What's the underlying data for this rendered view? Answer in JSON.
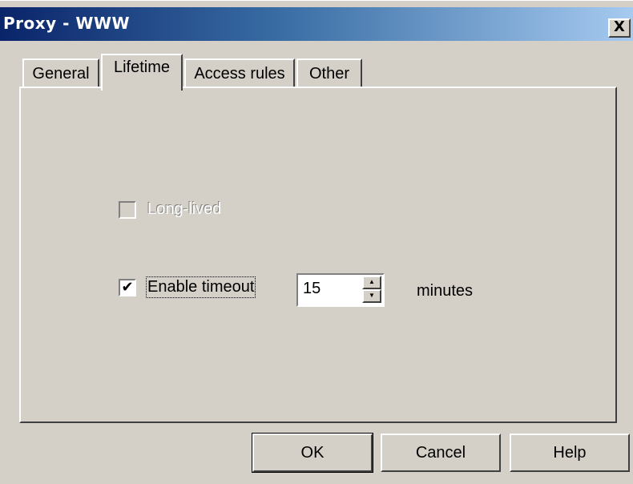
{
  "window": {
    "title": "Proxy - WWW",
    "close_label": "X"
  },
  "tabs": [
    {
      "label": "General",
      "active": false
    },
    {
      "label": "Lifetime",
      "active": true
    },
    {
      "label": "Access rules",
      "active": false
    },
    {
      "label": "Other",
      "active": false
    }
  ],
  "lifetime": {
    "long_lived": {
      "label": "Long-lived",
      "checked": false,
      "enabled": false
    },
    "enable_timeout": {
      "label": "Enable timeout",
      "checked": true,
      "enabled": true,
      "check_glyph": "✔"
    },
    "timeout_value": "15",
    "timeout_unit": "minutes",
    "spin_up_glyph": "▲",
    "spin_down_glyph": "▼"
  },
  "buttons": {
    "ok": "OK",
    "cancel": "Cancel",
    "help": "Help"
  },
  "colors": {
    "face": "#d4d0c8",
    "title_start": "#0a246a",
    "title_end": "#a6caf0"
  }
}
